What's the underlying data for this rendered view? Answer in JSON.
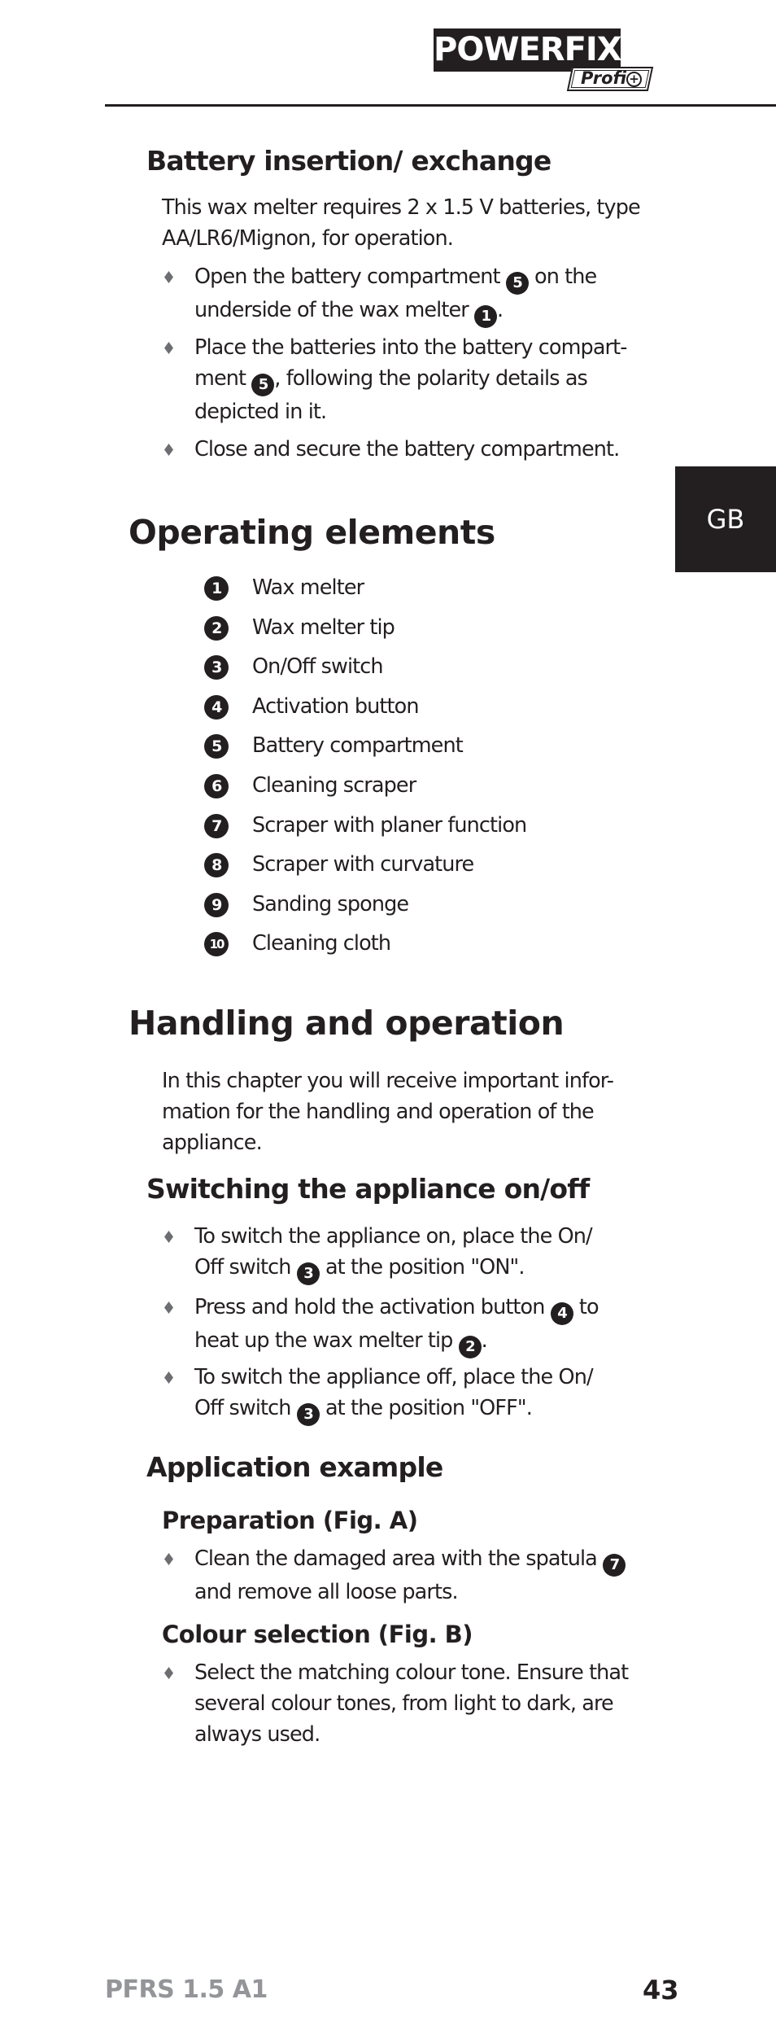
{
  "header": {
    "brand": "POWERFIX",
    "brand_mark": "®",
    "sub_brand": "Profi",
    "sub_brand_symbol": "+"
  },
  "language_tab": "GB",
  "sections": {
    "battery": {
      "heading": "Battery insertion/ exchange",
      "intro_lines": [
        "This wax melter requires 2 x 1.5 V batteries, type",
        "AA/LR6/Mignon, for operation."
      ],
      "bullets": [
        {
          "lines": [
            [
              "Open the battery compartment ",
              {
                "ref": "5"
              },
              " on the"
            ],
            [
              "underside of the wax melter ",
              {
                "ref": "1"
              },
              "."
            ]
          ]
        },
        {
          "lines": [
            [
              "Place the batteries into the battery compart-"
            ],
            [
              "ment ",
              {
                "ref": "5"
              },
              ", following the polarity details as"
            ],
            [
              "depicted in it."
            ]
          ]
        },
        {
          "lines": [
            [
              "Close and secure the battery compartment."
            ]
          ]
        }
      ]
    },
    "operating_elements": {
      "heading": "Operating elements",
      "items": [
        {
          "num": "1",
          "label": "Wax melter"
        },
        {
          "num": "2",
          "label": "Wax melter tip"
        },
        {
          "num": "3",
          "label": "On/Off switch"
        },
        {
          "num": "4",
          "label": "Activation button"
        },
        {
          "num": "5",
          "label": "Battery compartment"
        },
        {
          "num": "6",
          "label": "Cleaning scraper"
        },
        {
          "num": "7",
          "label": "Scraper with planer function"
        },
        {
          "num": "8",
          "label": "Scraper with curvature"
        },
        {
          "num": "9",
          "label": "Sanding sponge"
        },
        {
          "num": "10",
          "label": "Cleaning cloth"
        }
      ]
    },
    "handling": {
      "heading": "Handling and operation",
      "intro_lines": [
        "In this chapter you will receive important infor-",
        "mation for the handling and operation of the",
        "appliance."
      ]
    },
    "switching": {
      "heading": "Switching the appliance on/off",
      "bullets": [
        {
          "lines": [
            [
              "To switch the appliance on, place the On/"
            ],
            [
              "Off switch ",
              {
                "ref": "3"
              },
              " at the position \"ON\"."
            ]
          ]
        },
        {
          "lines": [
            [
              "Press and hold the activation button ",
              {
                "ref": "4"
              },
              " to"
            ],
            [
              "heat up the wax melter tip ",
              {
                "ref": "2"
              },
              "."
            ]
          ]
        },
        {
          "lines": [
            [
              "To switch the appliance off, place the On/"
            ],
            [
              "Off switch ",
              {
                "ref": "3"
              },
              " at the position \"OFF\"."
            ]
          ]
        }
      ]
    },
    "application": {
      "heading": "Application example",
      "preparation": {
        "heading": "Preparation (Fig. A)",
        "bullets": [
          {
            "lines": [
              [
                "Clean the damaged area with the spatula ",
                {
                  "ref": "7"
                }
              ],
              [
                "and remove all loose parts."
              ]
            ]
          }
        ]
      },
      "colour": {
        "heading": "Colour selection (Fig. B)",
        "bullets": [
          {
            "lines": [
              [
                "Select the matching colour tone. Ensure that"
              ],
              [
                "several colour tones, from light to dark, are"
              ],
              [
                "always used."
              ]
            ]
          }
        ]
      }
    }
  },
  "footer": {
    "model": "PFRS 1.5 A1",
    "page_number": "43"
  },
  "colors": {
    "text": "#231f20",
    "bullet": "#6d6e71",
    "footer_model": "#939598",
    "tab_bg": "#231f20"
  }
}
